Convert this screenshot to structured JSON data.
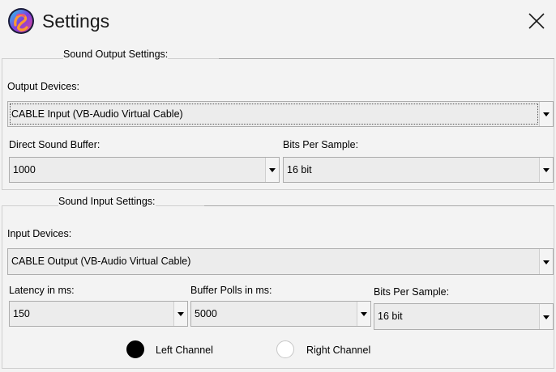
{
  "window": {
    "title": "Settings",
    "close_icon": "close-icon",
    "logo_icon": "app-logo-icon",
    "accent_colors": [
      "#e84a8a",
      "#7b3fe4",
      "#ff9a2e",
      "#2ad0e8"
    ]
  },
  "output_section": {
    "legend": "Sound Output Settings:",
    "device_label": "Output Devices:",
    "device_value": "CABLE Input (VB-Audio Virtual Cable)",
    "buffer_label": "Direct Sound Buffer:",
    "buffer_value": "1000",
    "bits_label": "Bits Per Sample:",
    "bits_value": "16 bit"
  },
  "input_section": {
    "legend": "Sound Input Settings:",
    "device_label": "Input Devices:",
    "device_value": "CABLE Output (VB-Audio Virtual Cable)",
    "latency_label": "Latency in ms:",
    "latency_value": "150",
    "polls_label": "Buffer Polls in ms:",
    "polls_value": "5000",
    "bits_label": "Bits Per Sample:",
    "bits_value": "16 bit",
    "channels": [
      {
        "label": "Left Channel",
        "checked": true
      },
      {
        "label": "Right Channel",
        "checked": false
      }
    ]
  }
}
